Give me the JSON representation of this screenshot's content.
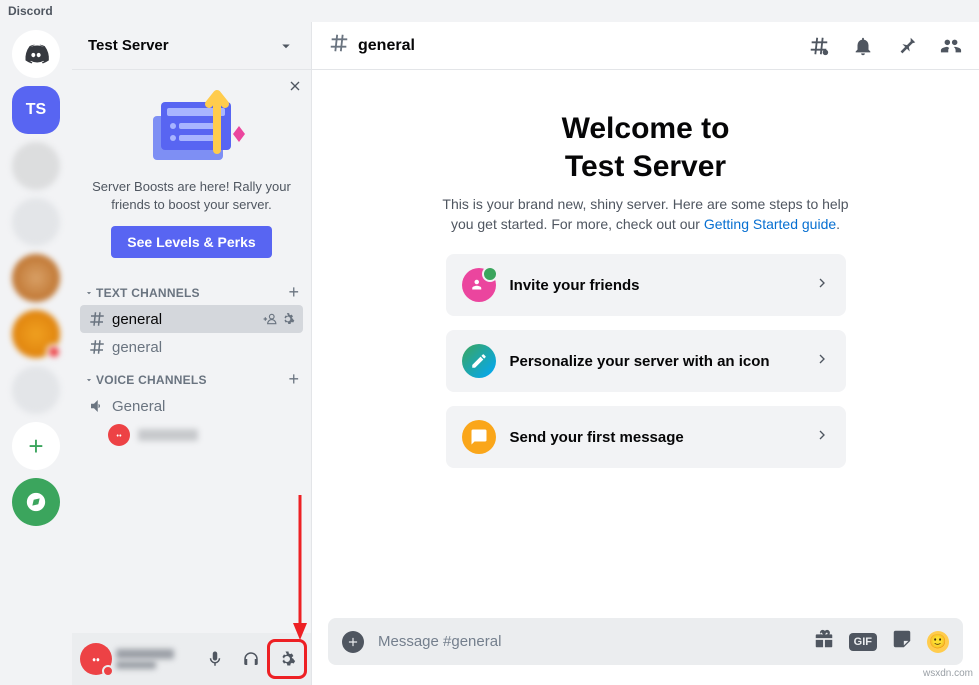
{
  "app_name": "Discord",
  "server": {
    "name": "Test Server",
    "initials": "TS"
  },
  "boost": {
    "text": "Server Boosts are here! Rally your friends to boost your server.",
    "button": "See Levels & Perks"
  },
  "categories": {
    "text": {
      "label": "TEXT CHANNELS"
    },
    "voice": {
      "label": "VOICE CHANNELS"
    }
  },
  "text_channels": [
    {
      "name": "general",
      "active": true
    },
    {
      "name": "general",
      "active": false
    }
  ],
  "voice_channels": [
    {
      "name": "General"
    }
  ],
  "header": {
    "channel": "general"
  },
  "welcome": {
    "title_line1": "Welcome to",
    "title_line2": "Test Server",
    "desc_pre": "This is your brand new, shiny server. Here are some steps to help you get started. For more, check out our ",
    "desc_link": "Getting Started guide",
    "desc_post": "."
  },
  "cards": [
    {
      "label": "Invite your friends"
    },
    {
      "label": "Personalize your server with an icon"
    },
    {
      "label": "Send your first message"
    }
  ],
  "composer": {
    "placeholder": "Message #general",
    "gif": "GIF"
  },
  "watermark": "wsxdn.com"
}
